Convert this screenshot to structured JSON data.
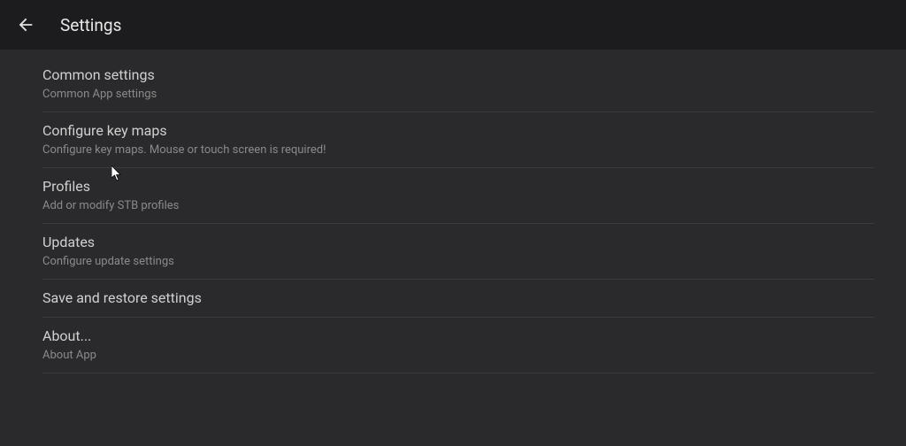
{
  "header": {
    "title": "Settings"
  },
  "items": [
    {
      "title": "Common settings",
      "subtitle": "Common App settings"
    },
    {
      "title": "Configure key maps",
      "subtitle": "Configure key maps. Mouse or touch screen is required!"
    },
    {
      "title": "Profiles",
      "subtitle": "Add or modify STB profiles"
    },
    {
      "title": "Updates",
      "subtitle": "Configure update settings"
    },
    {
      "title": "Save and restore settings",
      "subtitle": ""
    },
    {
      "title": "About...",
      "subtitle": "About App"
    }
  ]
}
